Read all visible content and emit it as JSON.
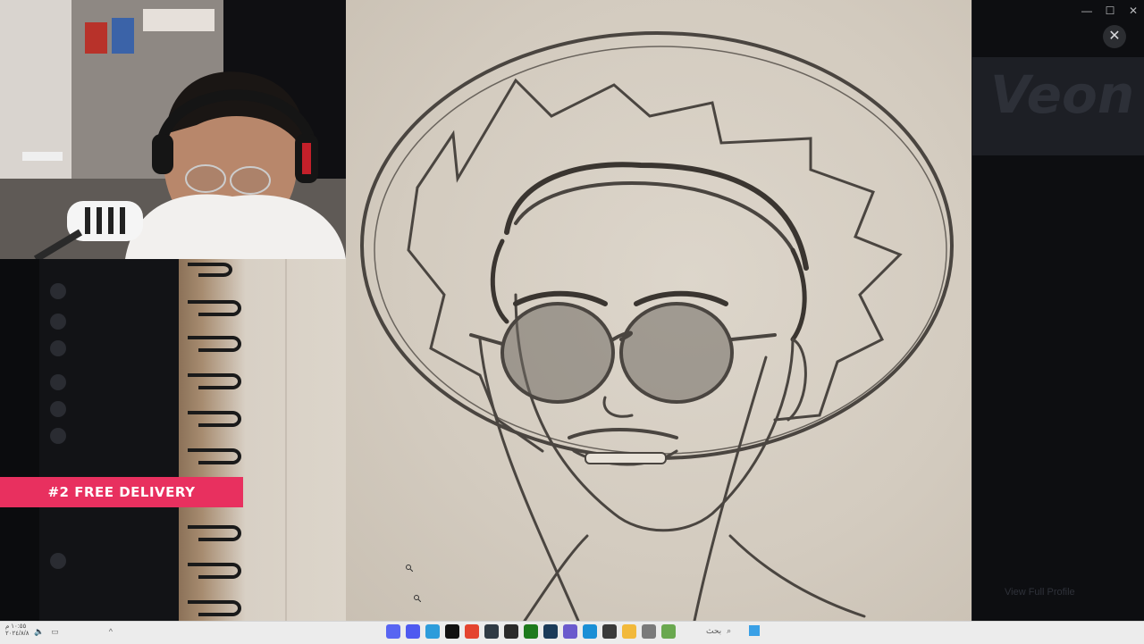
{
  "promo": {
    "label": "#2 FREE DELIVERY"
  },
  "window": {
    "minimize": "—",
    "maximize": "☐",
    "close": "✕"
  },
  "viewer": {
    "close_label": "✕"
  },
  "background_app": {
    "banner_text": "Veon",
    "view_profile": "View Full Profile"
  },
  "taskbar": {
    "clock_time": "١٠:٥٥ م",
    "clock_date": "٢٠٢٤/٨/٨",
    "search_label": "بحث",
    "tray_arrow": "^",
    "app_icons": [
      {
        "name": "discord-icon",
        "color": "#5865f2"
      },
      {
        "name": "discord-ptb-icon",
        "color": "#4e5af0"
      },
      {
        "name": "assistant-icon",
        "color": "#2d9cdb"
      },
      {
        "name": "tiktok-icon",
        "color": "#111111"
      },
      {
        "name": "chrome-icon",
        "color": "#e4442f"
      },
      {
        "name": "terminal-icon",
        "color": "#2f3a44"
      },
      {
        "name": "obs-icon",
        "color": "#2a2a2a"
      },
      {
        "name": "xbox-icon",
        "color": "#1d7a1d"
      },
      {
        "name": "steam-icon",
        "color": "#1b3b5a"
      },
      {
        "name": "photo-icon",
        "color": "#6a5acd"
      },
      {
        "name": "edge-icon",
        "color": "#1a8fd6"
      },
      {
        "name": "calculator-icon",
        "color": "#3a3a3a"
      },
      {
        "name": "folder-icon",
        "color": "#f2b93b"
      },
      {
        "name": "settings-icon",
        "color": "#7a7a7a"
      },
      {
        "name": "minecraft-icon",
        "color": "#6aa84f"
      }
    ]
  }
}
